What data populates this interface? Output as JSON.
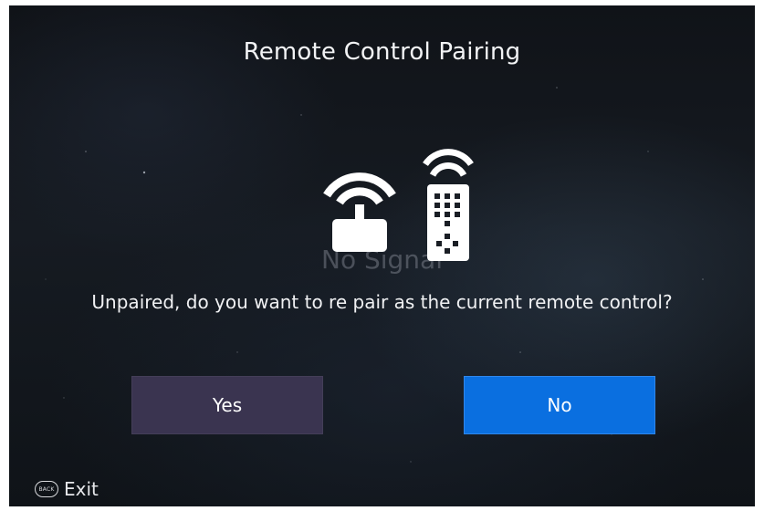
{
  "dialog": {
    "title": "Remote Control Pairing",
    "background_watermark": "No Signal",
    "message": "Unpaired, do you want to re pair as the current remote control?",
    "buttons": {
      "yes_label": "Yes",
      "no_label": "No"
    }
  },
  "footer": {
    "back_key_label": "BACK",
    "exit_label": "Exit"
  },
  "colors": {
    "yes_button": "#3a3450",
    "no_button_focused": "#0a6fe0",
    "text": "#f2f3f5"
  },
  "icons": [
    "wifi-router-icon",
    "remote-control-icon",
    "back-key-icon"
  ]
}
